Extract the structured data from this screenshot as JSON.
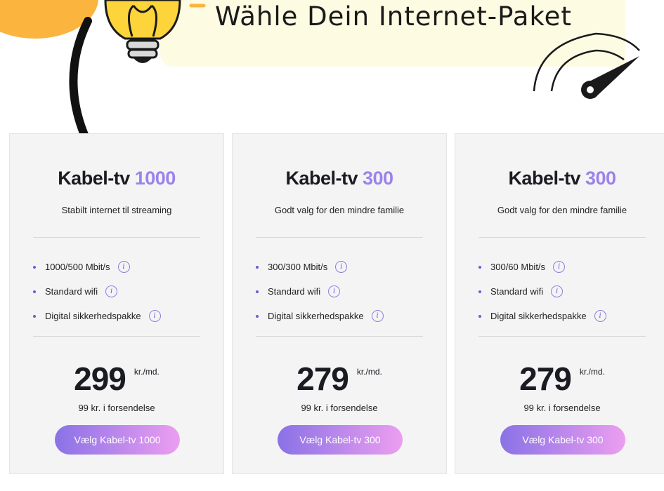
{
  "banner": {
    "title": "Wähle Dein Internet-Paket"
  },
  "icons": {
    "lightbulb": "lightbulb-icon",
    "speedometer": "speedometer-icon",
    "arrow": "curved-arrow-icon",
    "info": "info-icon"
  },
  "colors": {
    "accent": "#9b83ea",
    "button_start": "#8a72e6",
    "button_end": "#ec9ef0",
    "card_bg": "#f4f4f5",
    "banner_bg": "#fdfbe2",
    "blob": "#fbb43e"
  },
  "plans": [
    {
      "title_main": "Kabel-tv",
      "title_speed": "1000",
      "subtitle": "Stabilt internet til streaming",
      "features": [
        "1000/500 Mbit/s",
        "Standard wifi",
        "Digital sikkerhedspakke"
      ],
      "info_glyph": "i",
      "price": "299",
      "unit": "kr./md.",
      "shipping": "99 kr. i forsendelse",
      "button": "Vælg Kabel-tv 1000"
    },
    {
      "title_main": "Kabel-tv",
      "title_speed": "300",
      "subtitle": "Godt valg for den mindre familie",
      "features": [
        "300/300 Mbit/s",
        "Standard wifi",
        "Digital sikkerhedspakke"
      ],
      "info_glyph": "i",
      "price": "279",
      "unit": "kr./md.",
      "shipping": "99 kr. i forsendelse",
      "button": "Vælg Kabel-tv 300"
    },
    {
      "title_main": "Kabel-tv",
      "title_speed": "300",
      "subtitle": "Godt valg for den mindre familie",
      "features": [
        "300/60 Mbit/s",
        "Standard wifi",
        "Digital sikkerhedspakke"
      ],
      "info_glyph": "i",
      "price": "279",
      "unit": "kr./md.",
      "shipping": "99 kr. i forsendelse",
      "button": "Vælg Kabel-tv 300"
    }
  ]
}
